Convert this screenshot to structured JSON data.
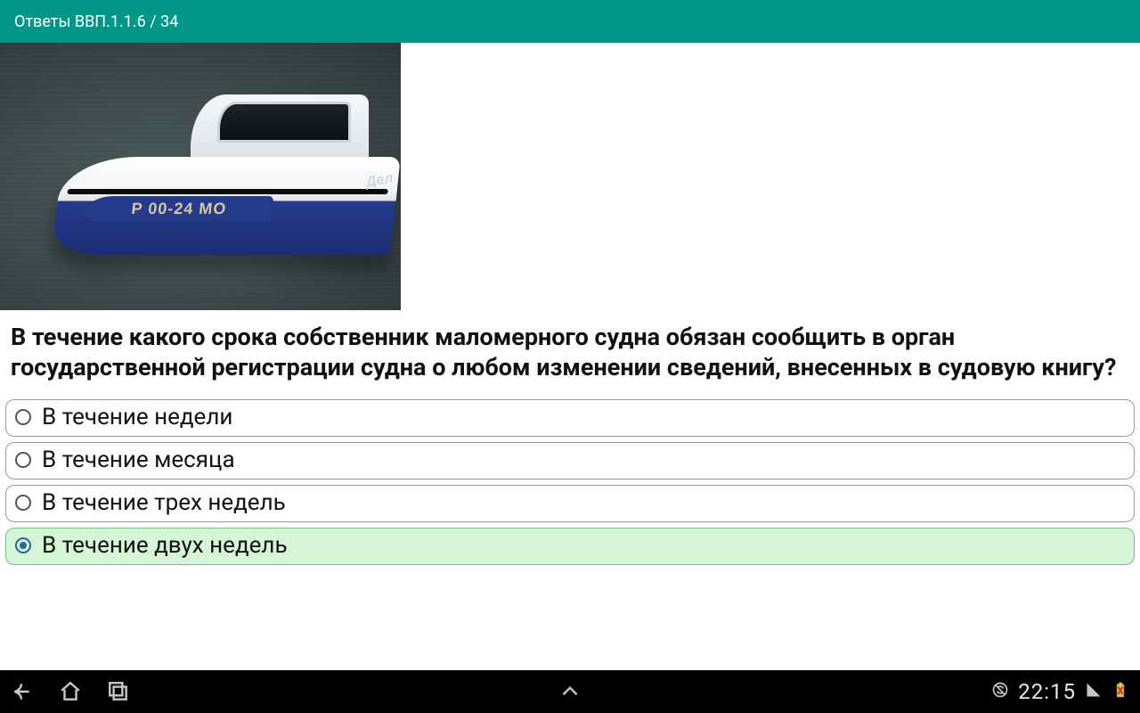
{
  "header": {
    "title": "Ответы ВВП.1.1.6 / 34"
  },
  "boat": {
    "registration": "P 00-24 MO",
    "stern_label": "Дел"
  },
  "question": "В течение какого срока собственник маломерного судна обязан сообщить в орган государственной регистрации судна о любом изменении сведений, внесенных в судовую книгу?",
  "options": [
    {
      "label": "В течение недели",
      "correct": false
    },
    {
      "label": "В течение месяца",
      "correct": false
    },
    {
      "label": "В течение трех недель",
      "correct": false
    },
    {
      "label": "В течение двух недель",
      "correct": true
    }
  ],
  "statusbar": {
    "time": "22:15"
  }
}
